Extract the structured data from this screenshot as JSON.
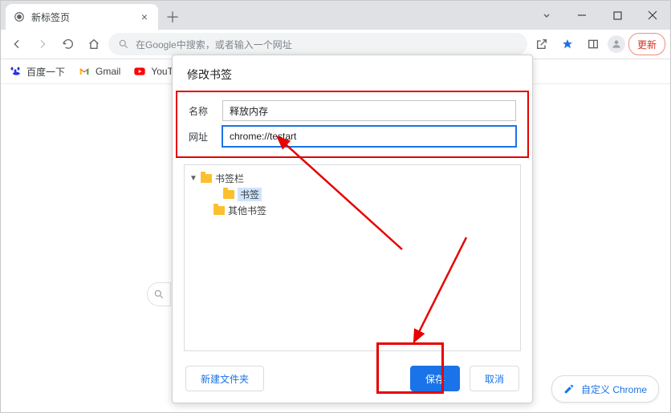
{
  "tab": {
    "title": "新标签页"
  },
  "omnibox": {
    "placeholder": "在Google中搜索，或者输入一个网址"
  },
  "update_button": "更新",
  "bookmarks_bar": {
    "items": [
      {
        "label": "百度一下"
      },
      {
        "label": "Gmail"
      },
      {
        "label": "YouTul"
      }
    ]
  },
  "dialog": {
    "title": "修改书签",
    "name_label": "名称",
    "name_value": "释放内存",
    "url_label": "网址",
    "url_value": "chrome://testart",
    "tree": {
      "root": "书签栏",
      "selected": "书签",
      "other": "其他书签"
    },
    "new_folder": "新建文件夹",
    "save": "保存",
    "cancel": "取消"
  },
  "customize_label": "自定义 Chrome"
}
